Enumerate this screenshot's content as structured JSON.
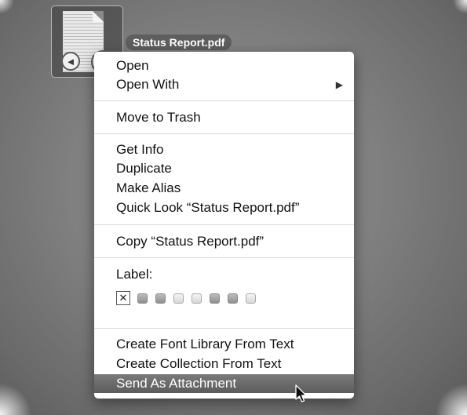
{
  "file": {
    "name": "Status Report.pdf",
    "icon": "pdf-document-icon",
    "quicklook_buttons": {
      "previous": "◄",
      "play": "◯"
    }
  },
  "menu": {
    "open": "Open",
    "open_with": "Open With",
    "submenu_arrow": "▶",
    "move_to_trash": "Move to Trash",
    "get_info": "Get Info",
    "duplicate": "Duplicate",
    "make_alias": "Make Alias",
    "quick_look": "Quick Look “Status Report.pdf”",
    "copy": "Copy “Status Report.pdf”",
    "label_heading": "Label:",
    "label_none": "✕",
    "label_colors": [
      "gray",
      "gray",
      "light-gray",
      "light-gray",
      "gray",
      "gray",
      "light-gray"
    ],
    "create_font_library": "Create Font Library From Text",
    "create_collection": "Create Collection From Text",
    "send_as_attachment": "Send As Attachment"
  },
  "colors": {
    "highlight": "#5c5c5c",
    "desktop": "#808080",
    "filename_bubble": "#5e5e5e"
  }
}
